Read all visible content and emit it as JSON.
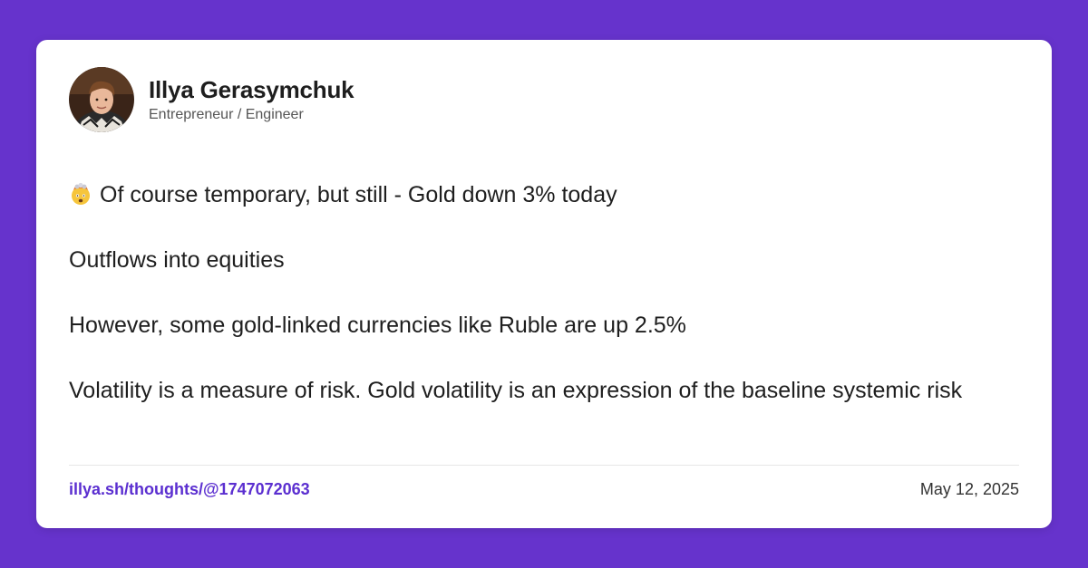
{
  "author": {
    "name": "Illya Gerasymchuk",
    "title": "Entrepreneur / Engineer"
  },
  "post": {
    "emoji_icon": "exploding-head-emoji",
    "paragraphs": [
      "Of course temporary, but still - Gold down 3% today",
      "Outflows into equities",
      "However, some gold-linked currencies like Ruble are up 2.5%",
      "Volatility is a measure of risk. Gold volatility is an expression of the baseline systemic risk"
    ]
  },
  "footer": {
    "link_text": "illya.sh/thoughts/@1747072063",
    "date": "May 12, 2025"
  },
  "colors": {
    "background": "#6633cc",
    "link": "#5b2fd0"
  }
}
